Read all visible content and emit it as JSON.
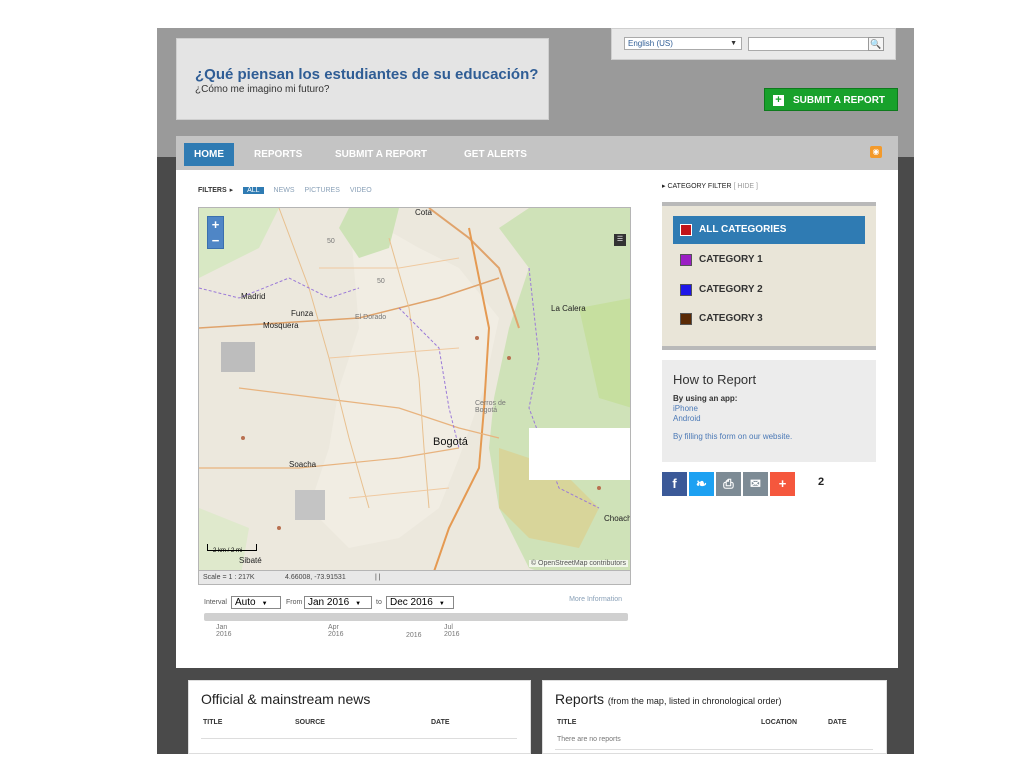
{
  "header": {
    "site_title": "¿Qué piensan los estudiantes de su educación?",
    "site_subtitle": "¿Cómo me imagino mi futuro?",
    "language": "English (US)",
    "search_value": "",
    "submit_report_label": "SUBMIT A REPORT"
  },
  "nav": {
    "items": [
      {
        "label": "HOME"
      },
      {
        "label": "REPORTS"
      },
      {
        "label": "SUBMIT A REPORT"
      },
      {
        "label": "GET ALERTS"
      }
    ]
  },
  "filters": {
    "label": "FILTERS",
    "items": [
      "ALL",
      "NEWS",
      "PICTURES",
      "VIDEO"
    ]
  },
  "map": {
    "places": [
      "Cota",
      "Madrid",
      "Funza",
      "Mosquera",
      "El Dorado",
      "La Calera",
      "Cerros de Bogotá",
      "Bogotá",
      "Soacha",
      "Sibaté",
      "Choach"
    ],
    "road_labels": [
      "50",
      "50"
    ],
    "attribution": "© OpenStreetMap contributors",
    "scale_text": "Scale = 1 : 217K",
    "coords": "4.66008, -73.91531",
    "scale_units": [
      "2 km",
      "2 mi"
    ]
  },
  "timeline": {
    "interval_label": "Interval",
    "interval_value": "Auto",
    "from_label": "From",
    "from_value": "Jan 2016",
    "to_label": "to",
    "to_value": "Dec 2016",
    "more_info": "More Information",
    "ticks": [
      {
        "month": "Jan",
        "year": "2016"
      },
      {
        "month": "Apr",
        "year": "2016"
      },
      {
        "month": "Jul",
        "year": "2016"
      }
    ],
    "center_year": "2016"
  },
  "category_filter": {
    "label": "CATEGORY FILTER",
    "hide_label": "HIDE",
    "items": [
      {
        "label": "ALL CATEGORIES",
        "color": "#c0141b"
      },
      {
        "label": "CATEGORY 1",
        "color": "#9b1fc4"
      },
      {
        "label": "CATEGORY 2",
        "color": "#1f17e8"
      },
      {
        "label": "CATEGORY 3",
        "color": "#5a2a05"
      }
    ]
  },
  "how_to": {
    "title": "How to Report",
    "subtitle": "By using an app:",
    "links": [
      "iPhone",
      "Android"
    ],
    "website": "By filling this form on our website."
  },
  "share": {
    "icons": [
      "facebook-icon",
      "twitter-icon",
      "print-icon",
      "email-icon",
      "plus-icon"
    ],
    "count": "2"
  },
  "news_panel": {
    "title": "Official & mainstream news",
    "columns": [
      "TITLE",
      "SOURCE",
      "DATE"
    ]
  },
  "reports_panel": {
    "title": "Reports",
    "subtitle": "(from the map, listed in chronological order)",
    "columns": [
      "TITLE",
      "LOCATION",
      "DATE"
    ],
    "empty": "There are no reports"
  }
}
